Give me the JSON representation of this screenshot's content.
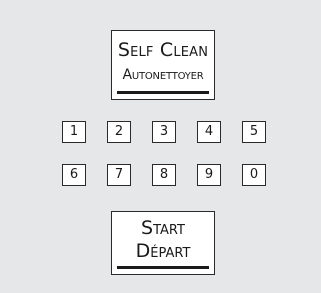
{
  "self_clean_button": {
    "line1": "Self Clean",
    "line2": "Autonettoyer"
  },
  "keypad": {
    "row1": [
      "1",
      "2",
      "3",
      "4",
      "5"
    ],
    "row2": [
      "6",
      "7",
      "8",
      "9",
      "0"
    ]
  },
  "start_button": {
    "line1": "Start",
    "line2": "Départ"
  },
  "colors": {
    "panel": "#e6e7e8",
    "button_face": "#ffffff",
    "border": "#2a2a2a"
  }
}
